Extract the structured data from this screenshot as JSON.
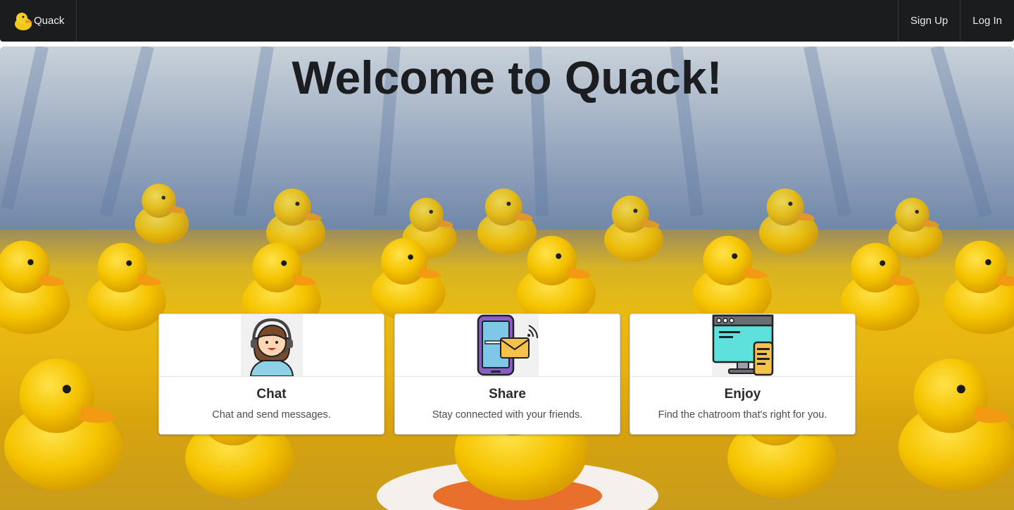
{
  "navbar": {
    "brand_label": "Quack",
    "links": [
      {
        "label": "Sign Up"
      },
      {
        "label": "Log In"
      }
    ]
  },
  "hero": {
    "title": "Welcome to Quack!"
  },
  "cards": [
    {
      "title": "Chat",
      "description": "Chat and send messages.",
      "icon": "support-agent-icon"
    },
    {
      "title": "Share",
      "description": "Stay connected with your friends.",
      "icon": "phone-message-icon"
    },
    {
      "title": "Enjoy",
      "description": "Find the chatroom that's right for you.",
      "icon": "devices-icon"
    }
  ],
  "colors": {
    "navbar_bg": "#1b1c1e",
    "duck_yellow": "#f5c400",
    "title_text": "#1b1d21"
  }
}
